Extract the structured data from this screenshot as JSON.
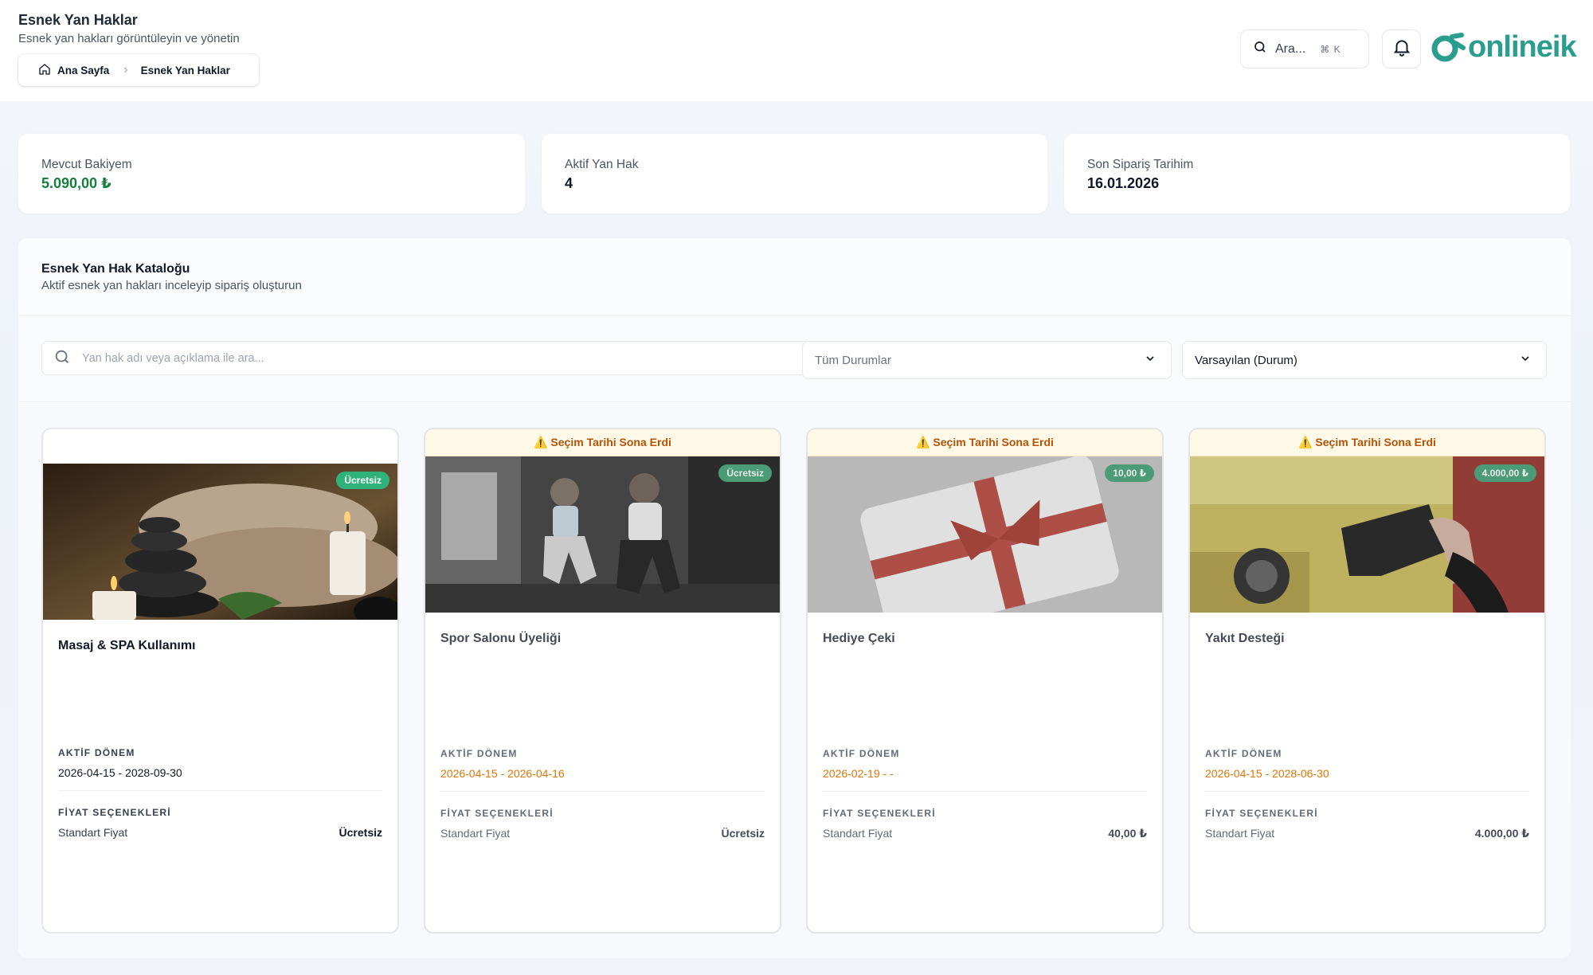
{
  "header": {
    "title": "Esnek Yan Haklar",
    "subtitle": "Esnek yan hakları görüntüleyin ve yönetin",
    "breadcrumb": {
      "home": "Ana Sayfa",
      "current": "Esnek Yan Haklar"
    },
    "search": {
      "label": "Ara...",
      "shortcut": "⌘ K"
    },
    "brand": "onlineik",
    "icons": [
      "home-icon",
      "chevron-right-icon",
      "search-icon",
      "bell-icon"
    ]
  },
  "stats": [
    {
      "label": "Mevcut Bakiyem",
      "value": "5.090,00 ₺"
    },
    {
      "label": "Aktif Yan Hak",
      "value": "4"
    },
    {
      "label": "Son Sipariş Tarihim",
      "value": "16.01.2026"
    }
  ],
  "catalog": {
    "title": "Esnek Yan Hak Kataloğu",
    "subtitle": "Aktif esnek yan hakları inceleyip sipariş oluşturun",
    "search_placeholder": "Yan hak adı veya açıklama ile ara...",
    "status_filter": "Tüm Durumlar",
    "sort": "Varsayılan (Durum)"
  },
  "cards": [
    {
      "title": "Masaj & SPA Kullanımı",
      "badge": "Ücretsiz",
      "warning": "",
      "period_label": "AKTİF DÖNEM",
      "period": "2026-04-15 - 2028-09-30",
      "price_label": "FİYAT SEÇENEKLERİ",
      "price_name": "Standart Fiyat",
      "price_value": "Ücretsiz",
      "image": "spa-stones-towels"
    },
    {
      "title": "Spor Salonu Üyeliği",
      "badge": "Ücretsiz",
      "warning": "⚠️ Seçim Tarihi Sona Erdi",
      "period_label": "AKTİF DÖNEM",
      "period": "2026-04-15 - 2026-04-16",
      "price_label": "FİYAT SEÇENEKLERİ",
      "price_name": "Standart Fiyat",
      "price_value": "Ücretsiz",
      "image": "gym-squat"
    },
    {
      "title": "Hediye Çeki",
      "badge": "10,00 ₺",
      "warning": "⚠️ Seçim Tarihi Sona Erdi",
      "period_label": "AKTİF DÖNEM",
      "period": "2026-02-19 - -",
      "price_label": "FİYAT SEÇENEKLERİ",
      "price_name": "Standart Fiyat",
      "price_value": "40,00 ₺",
      "image": "gift-card-red-ribbon"
    },
    {
      "title": "Yakıt Desteği",
      "badge": "4.000,00 ₺",
      "warning": "⚠️ Seçim Tarihi Sona Erdi",
      "period_label": "AKTİF DÖNEM",
      "period": "2026-04-15 - 2028-06-30",
      "price_label": "FİYAT SEÇENEKLERİ",
      "price_name": "Standart Fiyat",
      "price_value": "4.000,00 ₺",
      "image": "fuel-nozzle"
    }
  ],
  "colors": {
    "brand": "#2a9d8f",
    "balance": "#15803d",
    "badge": "#2fb37a",
    "warning_text": "#b45309",
    "period_expired": "#d97706"
  }
}
